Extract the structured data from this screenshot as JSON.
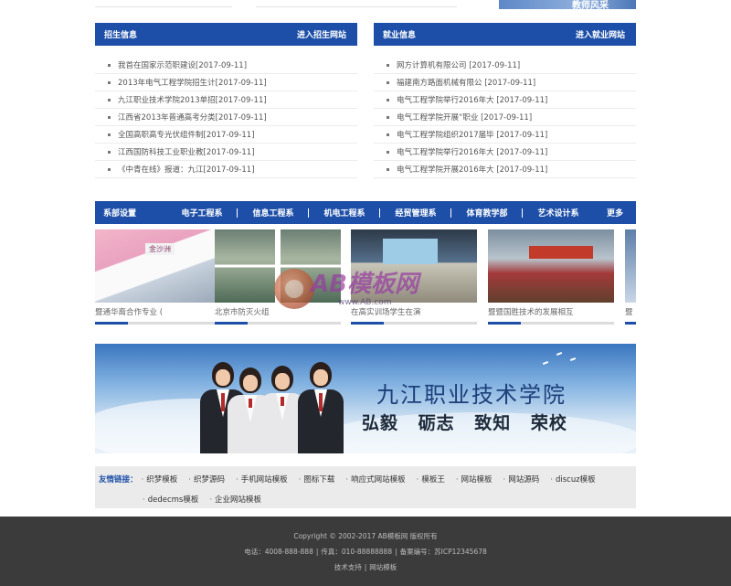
{
  "top_fragment": {
    "banner_text": "教师风采"
  },
  "admissions": {
    "title": "招生信息",
    "more": "进入招生网站",
    "items": [
      "我首在国家示范职建设[2017-09-11]",
      "2013年电气工程学院招生计[2017-09-11]",
      "九江职业技术学院2013单招[2017-09-11]",
      "江西省2013年普通高考分类[2017-09-11]",
      "全国高职高专光伏组件制[2017-09-11]",
      "江西国防科技工业职业教[2017-09-11]",
      "《中青在线》报道：九江[2017-09-11]"
    ]
  },
  "employment": {
    "title": "就业信息",
    "more": "进入就业网站",
    "items": [
      "网方计算机有限公司 [2017-09-11]",
      "福建南方路面机械有限公 [2017-09-11]",
      "电气工程学院举行2016年大 [2017-09-11]",
      "电气工程学院开展“职业 [2017-09-11]",
      "电气工程学院组织2017届毕 [2017-09-11]",
      "电气工程学院举行2016年大 [2017-09-11]",
      "电气工程学院开展2016年大 [2017-09-11]"
    ]
  },
  "departments": {
    "title": "系部设置",
    "tabs": [
      "电子工程系",
      "信息工程系",
      "机电工程系",
      "经贸管理系",
      "体育教学部",
      "艺术设计系"
    ],
    "more": "更多"
  },
  "gallery": {
    "cards": [
      {
        "caption": "暨通华裔合作专业 (",
        "sign": "金沙洲"
      },
      {
        "caption": "北京市防灭火组"
      },
      {
        "caption": "在高实训场学生在演"
      },
      {
        "caption": "暨暨国胜技术的发展相互"
      },
      {
        "caption": "暨"
      }
    ]
  },
  "watermark": {
    "brand": "AB模板网",
    "url": "www.AB.com"
  },
  "banner": {
    "title": "九江职业技术学院",
    "slogan": "弘毅 砺志 致知 荣校"
  },
  "friend_links": {
    "label": "友情链接：",
    "row1": [
      "织梦模板",
      "织梦源码",
      "手机网站模板",
      "图标下载",
      "响应式网站模板",
      "模板王",
      "网站模板",
      "网站源码",
      "discuz模板"
    ],
    "row2": [
      "dedecms模板",
      "企业网站模板"
    ]
  },
  "footer": {
    "copyright": "Copyright © 2002-2017 AB模板网 版权所有",
    "phone": "电话：4008-888-888",
    "fax": "传真：010-88888888",
    "icp": "备案编号：苏ICP12345678",
    "support": "技术支持",
    "support_link": "网站模板"
  }
}
